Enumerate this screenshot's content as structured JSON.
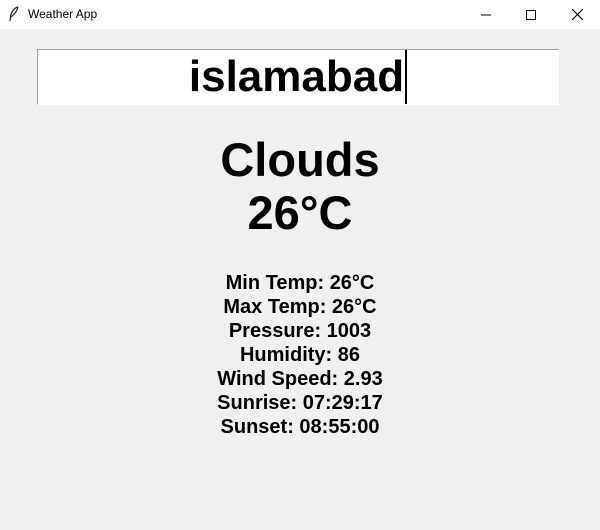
{
  "window": {
    "title": "Weather App",
    "icon": "feather-icon"
  },
  "search": {
    "value": "islamabad"
  },
  "weather": {
    "condition": "Clouds",
    "temperature": "26°C",
    "details": [
      "Min Temp: 26°C",
      "Max Temp: 26°C",
      "Pressure: 1003",
      "Humidity: 86",
      "Wind Speed: 2.93",
      "Sunrise: 07:29:17",
      "Sunset: 08:55:00"
    ]
  }
}
